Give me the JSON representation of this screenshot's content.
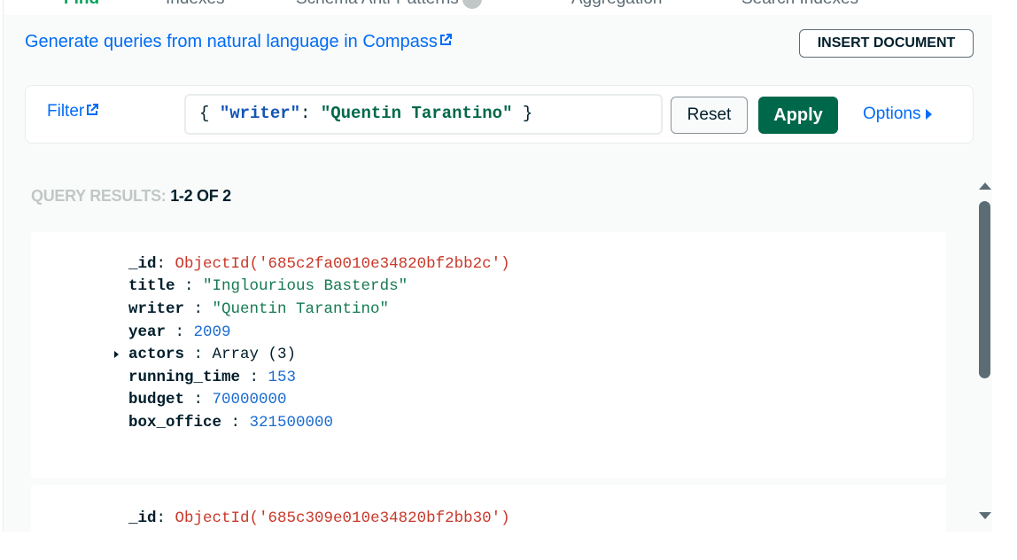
{
  "tabs": [
    {
      "label": "Find"
    },
    {
      "label": "Indexes"
    },
    {
      "label": "Schema Anti-Patterns"
    },
    {
      "label": "Aggregation"
    },
    {
      "label": "Search Indexes"
    }
  ],
  "header": {
    "generate_link": "Generate queries from natural language in Compass",
    "insert_button": "INSERT DOCUMENT"
  },
  "query": {
    "filter_label": "Filter",
    "filter_open": "{ ",
    "filter_key": "\"writer\"",
    "filter_colon": ": ",
    "filter_value": "\"Quentin Tarantino\"",
    "filter_close": " }",
    "reset_label": "Reset",
    "apply_label": "Apply",
    "options_label": "Options"
  },
  "results": {
    "label_prefix": "QUERY RESULTS:",
    "label_range": "1-2 OF 2"
  },
  "documents": [
    {
      "fields": [
        {
          "key": "_id",
          "sep": ": ",
          "value": "ObjectId('685c2fa0010e34820bf2bb2c')"
        },
        {
          "key": "title",
          "sep": " : ",
          "value": "\"Inglourious Basterds\""
        },
        {
          "key": "writer",
          "sep": " : ",
          "value": "\"Quentin Tarantino\""
        },
        {
          "key": "year",
          "sep": " : ",
          "value": "2009"
        },
        {
          "key": "actors",
          "sep": " : ",
          "value": "Array (3)"
        },
        {
          "key": "running_time",
          "sep": " : ",
          "value": "153"
        },
        {
          "key": "budget",
          "sep": " : ",
          "value": "70000000"
        },
        {
          "key": "box_office",
          "sep": " : ",
          "value": "321500000"
        }
      ]
    },
    {
      "fields": [
        {
          "key": "_id",
          "sep": ": ",
          "value": "ObjectId('685c309e010e34820bf2bb30')"
        }
      ]
    }
  ],
  "colors": {
    "accent_green": "#00684a",
    "link_blue": "#016bf8",
    "objectid_red": "#c9382a",
    "string_green": "#167a52",
    "number_blue": "#1a6bd0"
  }
}
